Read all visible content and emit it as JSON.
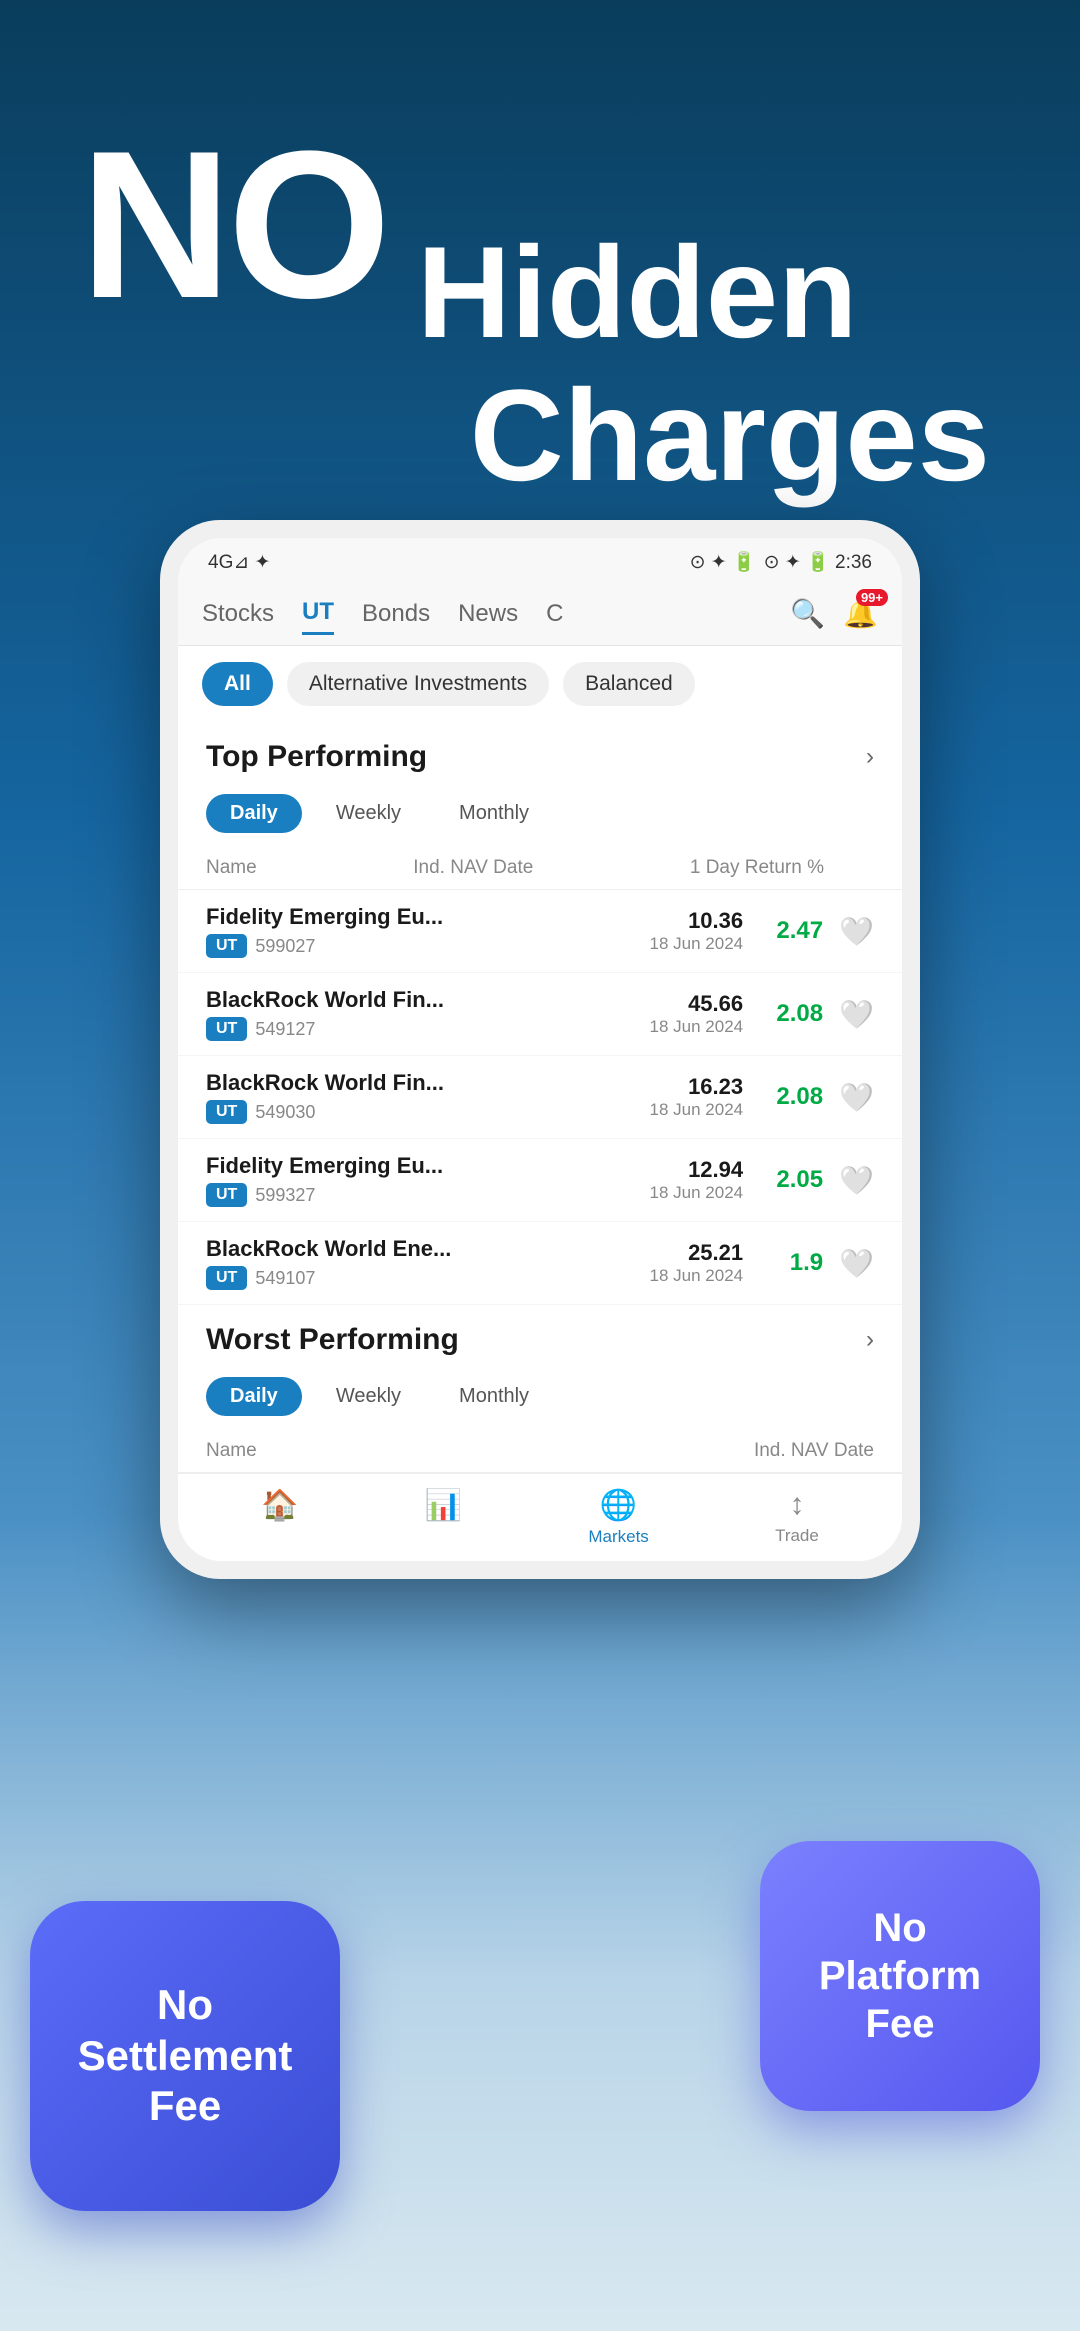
{
  "hero": {
    "no": "NO",
    "hidden": "Hidden",
    "charges": "Charges"
  },
  "status_bar": {
    "left": "4G  ⊿  ⊿  ✦",
    "right": "⊙  ✦  🔋  2:36"
  },
  "nav": {
    "tabs": [
      "Stocks",
      "UT",
      "Bonds",
      "News",
      "C"
    ],
    "active_tab": "UT",
    "bell_badge": "99+"
  },
  "filters": {
    "chips": [
      "All",
      "Alternative Investments",
      "Balanced"
    ],
    "active": "All"
  },
  "top_performing": {
    "title": "Top Performing",
    "periods": [
      "Daily",
      "Weekly",
      "Monthly"
    ],
    "active_period": "Daily",
    "col_name": "Name",
    "col_nav": "Ind. NAV Date",
    "col_return": "1 Day Return %",
    "funds": [
      {
        "name": "Fidelity Emerging Eu...",
        "tag": "UT",
        "code": "599027",
        "nav": "10.36",
        "date": "18 Jun 2024",
        "return": "2.47"
      },
      {
        "name": "BlackRock World Fin...",
        "tag": "UT",
        "code": "549127",
        "nav": "45.66",
        "date": "18 Jun 2024",
        "return": "2.08"
      },
      {
        "name": "BlackRock World Fin...",
        "tag": "UT",
        "code": "549030",
        "nav": "16.23",
        "date": "18 Jun 2024",
        "return": "2.08"
      },
      {
        "name": "Fidelity Emerging Eu...",
        "tag": "UT",
        "code": "599327",
        "nav": "12.94",
        "date": "18 Jun 2024",
        "return": "2.05"
      },
      {
        "name": "BlackRock World Ene...",
        "tag": "UT",
        "code": "549107",
        "nav": "25.21",
        "date": "18 Jun 2024",
        "return": "1.9"
      }
    ]
  },
  "worst_performing": {
    "title": "Worst Performing",
    "periods": [
      "Daily",
      "Weekly",
      "Monthly"
    ],
    "active_period": "Daily",
    "col_name": "Name",
    "col_nav": "Ind. NAV Date"
  },
  "bottom_nav": {
    "items": [
      "Home",
      "Markets",
      "Trade"
    ],
    "active": "Markets",
    "icons": [
      "🏠",
      "📊",
      "🌐",
      "↕"
    ]
  },
  "badges": {
    "settlement": "No\nSettlement\nFee",
    "platform": "No\nPlatform\nFee"
  }
}
